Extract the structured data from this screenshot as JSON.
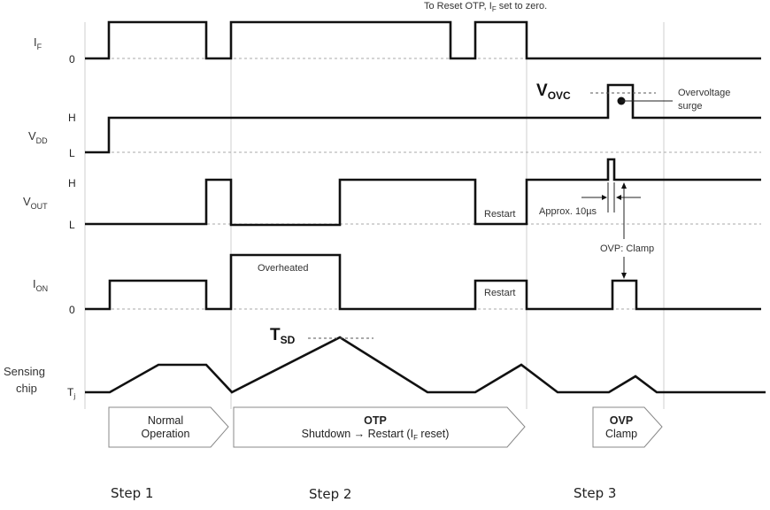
{
  "top_note": {
    "prefix": "To Reset OTP, I",
    "sub": "F",
    "suffix": " set to zero."
  },
  "signals": {
    "if": {
      "name": "I",
      "sub": "F",
      "levels": [
        "0"
      ]
    },
    "vdd": {
      "name": "V",
      "sub": "DD",
      "levels": [
        "H",
        "L"
      ]
    },
    "vout": {
      "name": "V",
      "sub": "OUT",
      "levels": [
        "H",
        "L"
      ]
    },
    "ion": {
      "name": "I",
      "sub": "ON",
      "levels": [
        "0"
      ]
    },
    "tj": {
      "name_line1": "Sensing",
      "name_line2": "chip",
      "level": "T",
      "level_sub": "j"
    }
  },
  "annotations": {
    "vovc": {
      "main": "V",
      "sub": "OVC"
    },
    "overvoltage": [
      "Overvoltage",
      "surge"
    ],
    "restart_vout": "Restart",
    "restart_ion": "Restart",
    "approx": "Approx.  10µs",
    "ovp_clamp": "OVP: Clamp",
    "overheated": "Overheated",
    "tsd": {
      "main": "T",
      "sub": "SD"
    }
  },
  "phases": [
    {
      "line1": "Normal",
      "line2": "Operation",
      "bold": false
    },
    {
      "line1": "OTP",
      "line2": "Shutdown → Restart (I",
      "line2_sub": "F",
      "line2_end": " reset)",
      "bold": true
    },
    {
      "line1": "OVP",
      "line2": "Clamp",
      "bold": true
    }
  ],
  "steps": [
    "Step 1",
    "Step 2",
    "Step 3"
  ]
}
